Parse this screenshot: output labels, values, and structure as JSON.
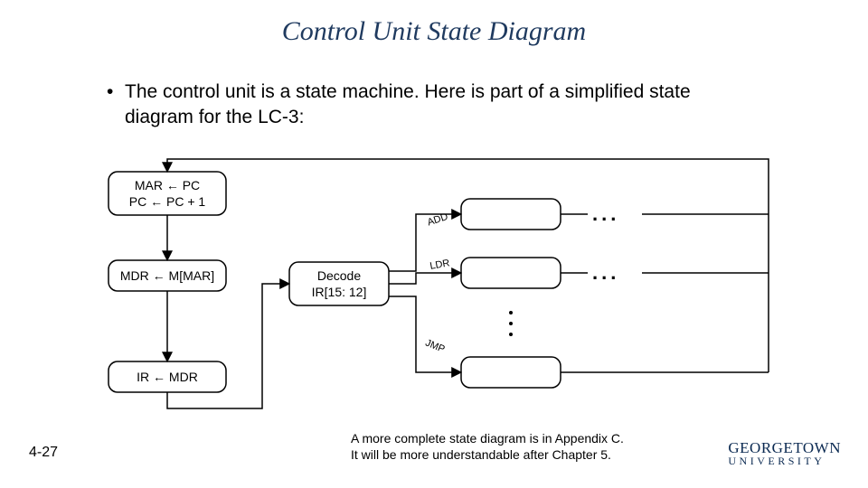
{
  "title": "Control Unit State Diagram",
  "bullet": "The control unit is a state machine.  Here is part of a simplified state diagram for the LC-3:",
  "note_line1": "A more complete state diagram is in Appendix C.",
  "note_line2": "It will be more understandable after Chapter 5.",
  "page": "4-27",
  "logo": {
    "line1": "GEORGETOWN",
    "line2": "UNIVERSITY"
  },
  "diagram": {
    "fetch": {
      "line1": "MAR ← PC",
      "line2": "PC ← PC + 1"
    },
    "mdr": "MDR ← M[MAR]",
    "ir": "IR ← MDR",
    "decode": {
      "line1": "Decode",
      "line2": "IR[15: 12]"
    },
    "branches": {
      "add": "ADD",
      "ldr": "LDR",
      "jmp": "JMP"
    },
    "hellip": "...",
    "vellip": "dots"
  }
}
